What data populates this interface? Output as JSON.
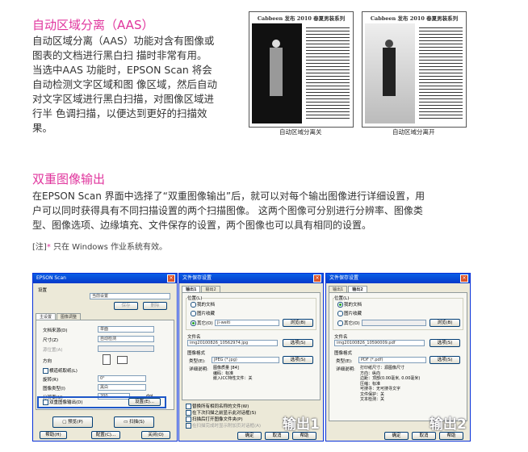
{
  "aas": {
    "heading": "自动区域分离（AAS）",
    "lines": [
      "自动区域分离（AAS）功能对含有图像或",
      "图表的文档进行黑白扫 描时非常有用。",
      "当选中AAS 功能时，EPSON Scan 将会",
      "自动检测文字区域和图 像区域，然后自动",
      "对文字区域进行黑白扫描，对图像区域进",
      "行半 色调扫描，以便达到更好的扫描效",
      "果。"
    ],
    "sample_off": {
      "title": "Cabbeen 发布 2010 春夏男装系列",
      "caption": "自动区域分离关"
    },
    "sample_on": {
      "title": "Cabbeen 发布 2010 春夏男装系列",
      "caption": "自动区域分离开"
    }
  },
  "dual": {
    "heading": "双重图像输出",
    "lines": [
      "在EPSON Scan 界面中选择了“双重图像输出”后，就可以对每个输出图像进行详细设置，用",
      "户可以同时获得具有不同扫描设置的两个扫描图像。 这两个图像可分别进行分辨率、图像类",
      "型、图像选项、边缘填充、文件保存的设置，两个图像也可以具有相同的设置。"
    ],
    "note_prefix": "[注]",
    "note_star": "*",
    "note_text": " 只在 Windows 作业系统有效。"
  },
  "win_main": {
    "title": "EPSON Scan",
    "close": "×",
    "settings_label": "设置",
    "settings_value": "当前设置",
    "save_btn": "保存",
    "delete_btn": "删除",
    "tab_main": "主设置",
    "tab_adjust": "图像调整",
    "rows": [
      {
        "label": "文档来源(D)",
        "value": "单面"
      },
      {
        "label": "尺寸(Z)",
        "value": "自动检测"
      },
      {
        "label": "源位置(A)",
        "value": ""
      },
      {
        "label": "方向",
        "value": ""
      },
      {
        "label": "旋转(R)",
        "value": "0°"
      },
      {
        "label": "图像类型(I)",
        "value": "黑白"
      },
      {
        "label": "分辨率(U)",
        "value": "200"
      }
    ],
    "landscape_check": "横道纸取纸(L)",
    "dpi_unit": "dpi",
    "dual_check": "双重图像输出(D)",
    "dual_settings_btn": "设置(E)...",
    "preview_btn": "预览(P)",
    "scan_btn": "扫描(S)",
    "help_btn": "帮助(H)",
    "config_btn": "配置(C)...",
    "close_btn": "关闭(O)"
  },
  "win_out1": {
    "title": "文件保存设置",
    "close": "×",
    "tab1": "输出1",
    "tab2": "输出2",
    "location_label": "位置(L)",
    "radio_docs": "我的文档",
    "radio_pics": "图片收藏",
    "radio_other": "其它(O)",
    "other_path": "ji-weiti",
    "browse_btn": "浏览(B)",
    "filename_label": "文件名",
    "filename_value": "img20100826_10562974.jpg",
    "select_btn1": "选项(S)",
    "format_label": "图像格式",
    "type_label": "类型(E):",
    "type_value": "JPEG (*.jpg)",
    "select_btn2": "选项(S)",
    "detail_label": "详细说明:",
    "detail_text": "图像质量 [84]\n编码：标准\n嵌入ICC特性文件：关",
    "check1": "替换所有相同名称的文件(W)",
    "check2": "在下次扫描之前显示此对话框(S)",
    "check3": "扫描后打开图像文件夹(P)",
    "check4": "在扫描完成时显示附加页对话框(A)",
    "ok_btn": "确定",
    "cancel_btn": "取消",
    "help_btn": "帮助",
    "output_label": "输出1"
  },
  "win_out2": {
    "title": "文件保存设置",
    "close": "×",
    "tab1": "输出1",
    "tab2": "输出2",
    "location_label": "位置(L)",
    "radio_docs": "我的文档",
    "radio_pics": "图片收藏",
    "radio_other": "其它(O)",
    "other_path": "",
    "browse_btn": "浏览(B)",
    "filename_label": "文件名",
    "filename_value": "img20100826_10590009.pdf",
    "select_btn1": "选项(S)",
    "format_label": "图像格式",
    "type_label": "类型(E):",
    "type_value": "PDF (*.pdf)",
    "select_btn2": "选项(S)",
    "detail_label": "详细说明:",
    "detail_text": "打印纸尺寸：源图像尺寸\n方向：纵向\n边距：顶部(0.00毫米, 0.00毫米)\n压缩：标准\n可搜寻：无可搜寻文字\n文件保护：关\n文本检测：关",
    "check1": "",
    "check2": "",
    "check3": "",
    "check4": "",
    "ok_btn": "确定",
    "cancel_btn": "取消",
    "help_btn": "帮助",
    "output_label": "输出2"
  }
}
